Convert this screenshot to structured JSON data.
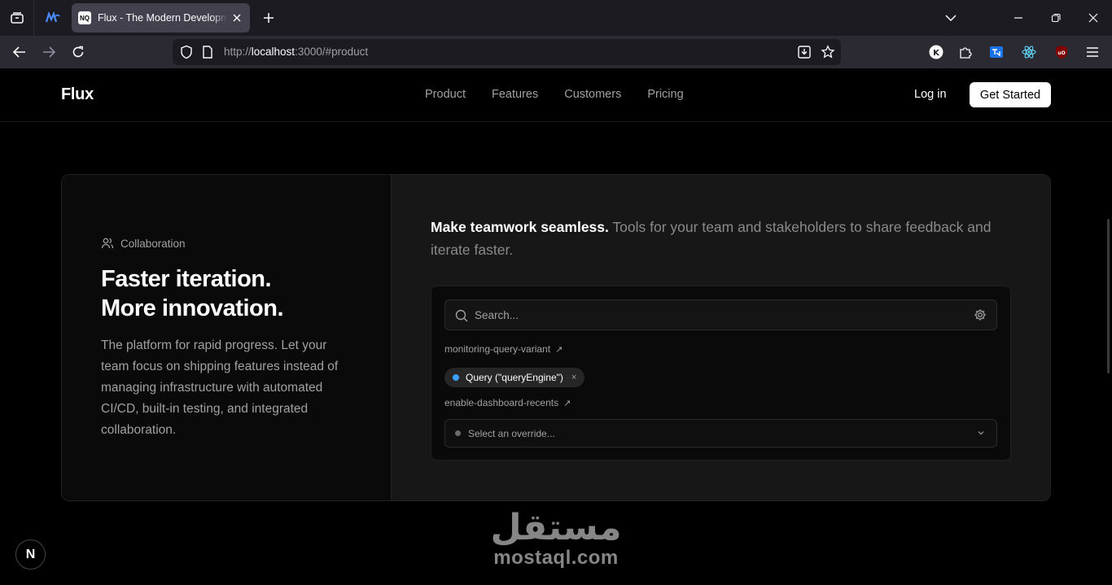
{
  "browser": {
    "tab_title": "Flux - The Modern Development Platform",
    "tab_favicon_text": "NQ",
    "url_prefix": "http://",
    "url_host": "localhost",
    "url_path": ":3000/#product",
    "extensions": [
      "k-extension-icon",
      "puzzle-icon",
      "translate-icon",
      "react-icon",
      "ublock-icon"
    ]
  },
  "site": {
    "logo": "Flux",
    "nav": [
      "Product",
      "Features",
      "Customers",
      "Pricing"
    ],
    "login": "Log in",
    "cta": "Get Started"
  },
  "section": {
    "eyebrow": "Collaboration",
    "headline_line1": "Faster iteration.",
    "headline_line2": "More innovation.",
    "body": "The platform for rapid progress. Let your team focus on shipping features instead of managing infrastructure with automated CI/CD, built-in testing, and integrated collaboration.",
    "tagline_bold": "Make teamwork seamless.",
    "tagline_rest": " Tools for your team and stakeholders to share feedback and iterate faster."
  },
  "panel": {
    "search_placeholder": "Search...",
    "flag1": "monitoring-query-variant",
    "flag1_arrow": "↗",
    "chip_label": "Query (\"queryEngine\")",
    "chip_close": "×",
    "flag2": "enable-dashboard-recents",
    "flag2_arrow": "↗",
    "select_placeholder": "Select an override..."
  },
  "dev_badge": "N",
  "watermark": {
    "arabic": "مستقل",
    "latin": "mostaql.com"
  },
  "colors": {
    "accent_dot": "#3b9eff",
    "background": "#000000",
    "card_right": "#171717"
  }
}
